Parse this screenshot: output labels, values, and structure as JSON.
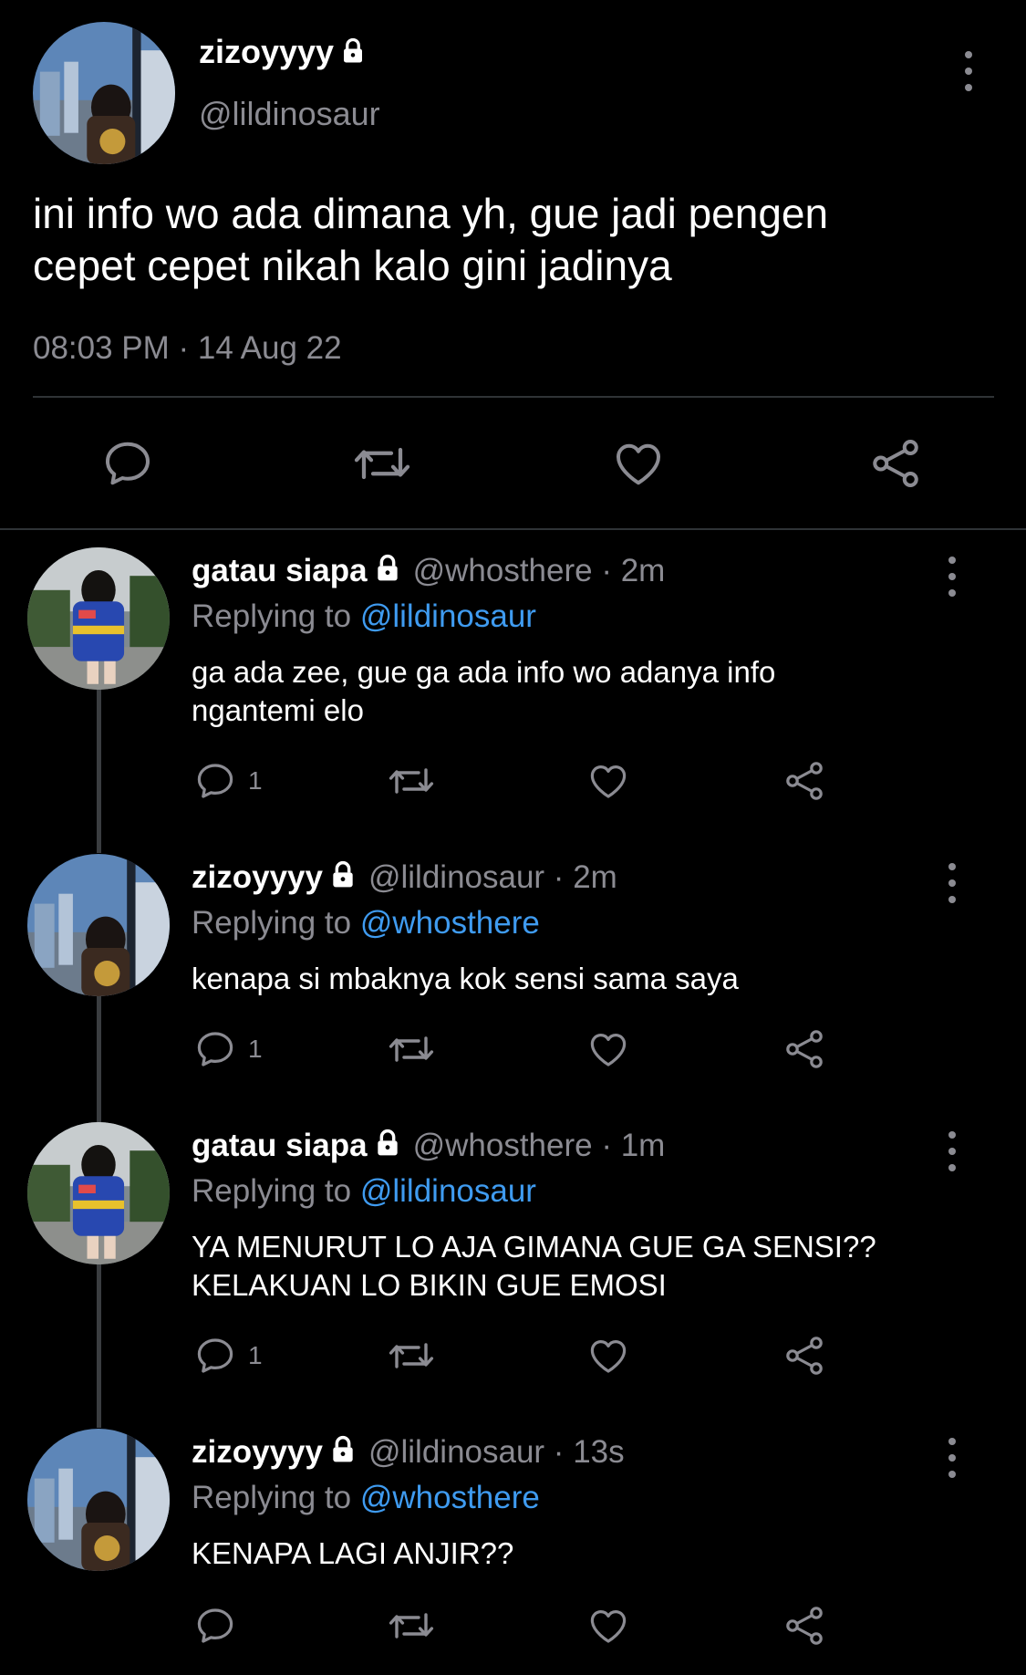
{
  "main_tweet": {
    "display_name": "zizoyyyy",
    "handle": "@lildinosaur",
    "text": "ini info wo ada dimana yh, gue jadi pengen\ncepet cepet nikah kalo gini jadinya",
    "timestamp": "08:03 PM · 14 Aug 22",
    "icons": {
      "protected": "lock-icon",
      "more": "more-vertical-icon",
      "reply": "reply-icon",
      "retweet": "retweet-icon",
      "like": "heart-icon",
      "share": "share-icon"
    }
  },
  "replies": [
    {
      "display_name": "gatau siapa",
      "handle_time": "@whosthere · 2m",
      "replying_label": "Replying to",
      "replying_to": "@lildinosaur",
      "text": "ga ada zee, gue ga ada info wo adanya info\nngantemi elo",
      "reply_count": "1"
    },
    {
      "display_name": "zizoyyyy",
      "handle_time": "@lildinosaur · 2m",
      "replying_label": "Replying to",
      "replying_to": "@whosthere",
      "text": "kenapa si mbaknya kok sensi sama saya",
      "reply_count": "1"
    },
    {
      "display_name": "gatau siapa",
      "handle_time": "@whosthere · 1m",
      "replying_label": "Replying to",
      "replying_to": "@lildinosaur",
      "text": "YA MENURUT LO AJA GIMANA GUE GA SENSI??\nKELAKUAN LO BIKIN GUE EMOSI",
      "reply_count": "1"
    },
    {
      "display_name": "zizoyyyy",
      "handle_time": "@lildinosaur · 13s",
      "replying_label": "Replying to",
      "replying_to": "@whosthere",
      "text": "KENAPA LAGI ANJIR??",
      "reply_count": ""
    }
  ],
  "colors": {
    "background": "#000000",
    "text": "#ffffff",
    "muted": "#8b8b92",
    "link": "#3f9bf0",
    "divider": "#2f3336"
  }
}
